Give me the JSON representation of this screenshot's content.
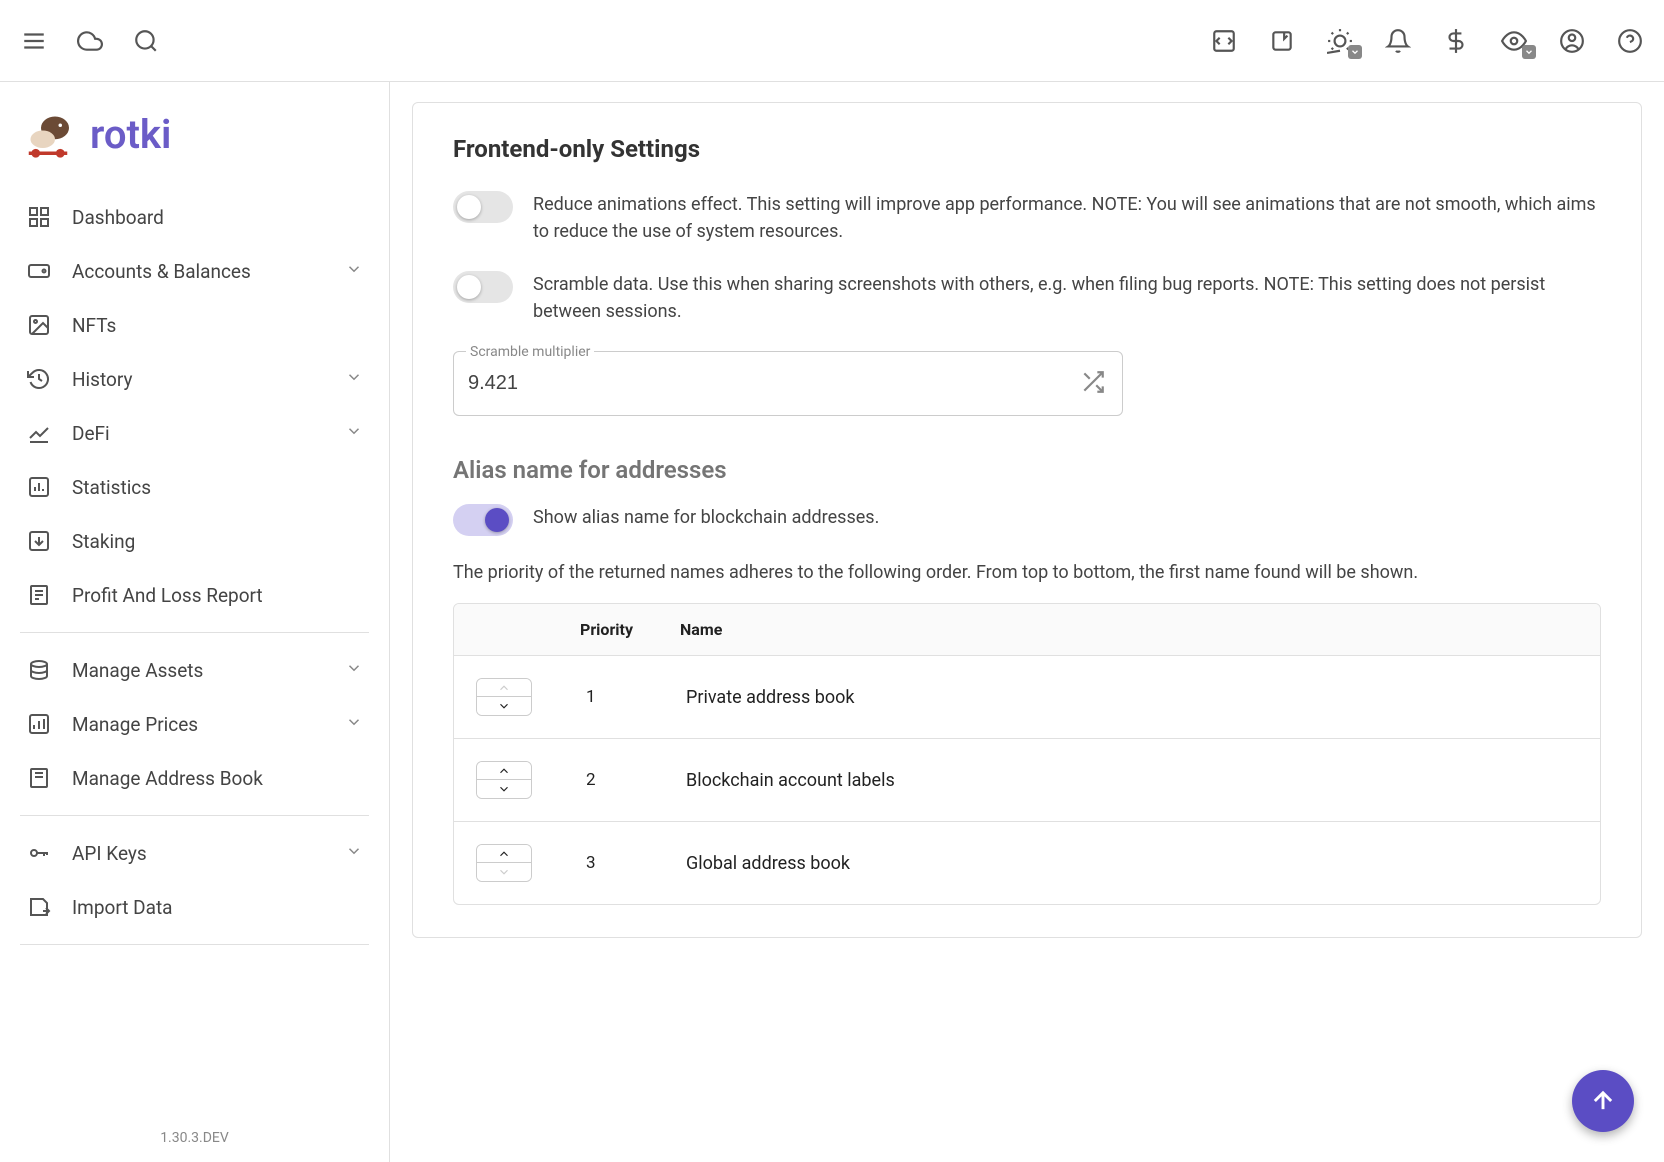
{
  "app": {
    "name": "rotki",
    "version": "1.30.3.DEV"
  },
  "sidebar": {
    "items": [
      {
        "label": "Dashboard"
      },
      {
        "label": "Accounts & Balances"
      },
      {
        "label": "NFTs"
      },
      {
        "label": "History"
      },
      {
        "label": "DeFi"
      },
      {
        "label": "Statistics"
      },
      {
        "label": "Staking"
      },
      {
        "label": "Profit And Loss Report"
      },
      {
        "label": "Manage Assets"
      },
      {
        "label": "Manage Prices"
      },
      {
        "label": "Manage Address Book"
      },
      {
        "label": "API Keys"
      },
      {
        "label": "Import Data"
      }
    ]
  },
  "settings": {
    "section_title": "Frontend-only Settings",
    "reduce_animations_desc": "Reduce animations effect. This setting will improve app performance. NOTE: You will see animations that are not smooth, which aims to reduce the use of system resources.",
    "scramble_data_desc": "Scramble data. Use this when sharing screenshots with others, e.g. when filing bug reports. NOTE: This setting does not persist between sessions.",
    "scramble_multiplier_label": "Scramble multiplier",
    "scramble_multiplier_value": "9.421",
    "alias_title": "Alias name for addresses",
    "alias_toggle_desc": "Show alias name for blockchain addresses.",
    "priority_desc": "The priority of the returned names adheres to the following order. From top to bottom, the first name found will be shown.",
    "table": {
      "head_priority": "Priority",
      "head_name": "Name",
      "rows": [
        {
          "priority": "1",
          "name": "Private address book"
        },
        {
          "priority": "2",
          "name": "Blockchain account labels"
        },
        {
          "priority": "3",
          "name": "Global address book"
        }
      ]
    }
  }
}
